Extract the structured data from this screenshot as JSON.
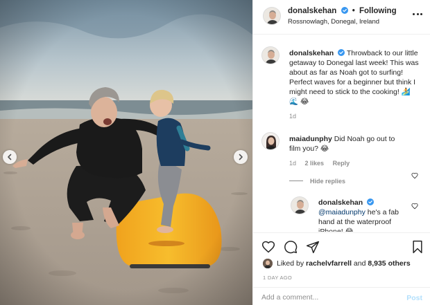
{
  "post": {
    "username": "donalskehan",
    "follow_label": "Following",
    "location": "Rossnowlagh, Donegal, Ireland",
    "photo_alt": "Man crouching on the beach teaching a toddler to stand on a yellow surfboard"
  },
  "caption": {
    "username": "donalskehan",
    "text": "Throwback to our little getaway to Donegal last week! This was about as far as Noah got to surfing! Perfect waves for a beginner but think I might need to stick to the cooking! 🏄 🌊 😂",
    "time": "1d"
  },
  "comments": [
    {
      "username": "maiadunphy",
      "text": "Did Noah go out to film you? 😂",
      "time": "1d",
      "likes": "2 likes",
      "reply_label": "Reply"
    }
  ],
  "hide_replies_label": "Hide replies",
  "reply": {
    "username": "donalskehan",
    "mention": "@maiadunphy",
    "text": "he's a fab hand at the waterproof iPhone! 😂"
  },
  "likes_line": {
    "prefix": "Liked by",
    "user": "rachelvfarrell",
    "connector": "and",
    "others": "8,935 others"
  },
  "date": "1 DAY AGO",
  "comment_box": {
    "placeholder": "Add a comment...",
    "post_label": "Post"
  },
  "icons": {
    "verified": "verified-badge-icon",
    "more": "more-options-icon",
    "like": "heart-icon",
    "comment": "comment-bubble-icon",
    "share": "paper-plane-icon",
    "save": "bookmark-icon",
    "prev": "chevron-left-icon",
    "next": "chevron-right-icon"
  },
  "colors": {
    "verified_blue": "#3897f0",
    "link_blue": "#00376b",
    "post_disabled": "#b2dffc",
    "secondary_text": "#8e8e8e",
    "surfboard": "#f5a623",
    "wetsuit": "#1c1c1c"
  }
}
